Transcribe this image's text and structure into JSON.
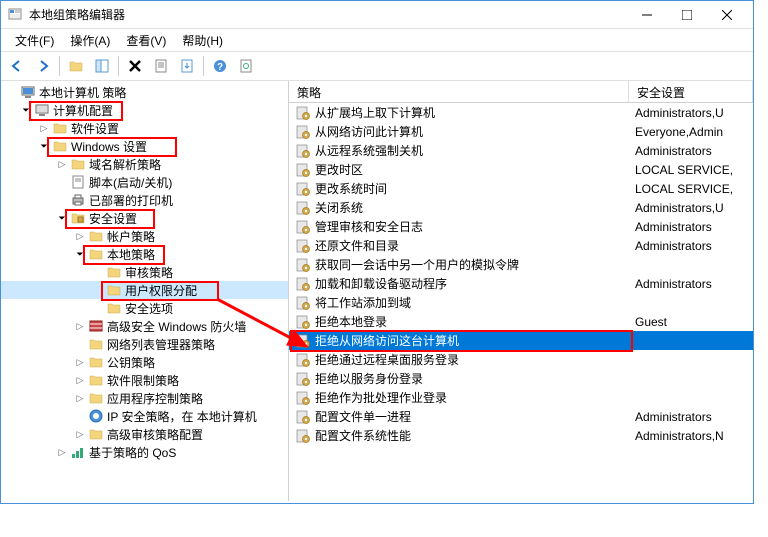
{
  "window": {
    "title": "本地组策略编辑器"
  },
  "menubar": {
    "file": "文件(F)",
    "action": "操作(A)",
    "view": "查看(V)",
    "help": "帮助(H)"
  },
  "tree": {
    "root": "本地计算机 策略",
    "computer_config": "计算机配置",
    "software_settings": "软件设置",
    "windows_settings": "Windows 设置",
    "name_resolution": "域名解析策略",
    "scripts": "脚本(启动/关机)",
    "deployed_printers": "已部署的打印机",
    "security_settings": "安全设置",
    "account_policies": "帐户策略",
    "local_policies": "本地策略",
    "audit_policy": "审核策略",
    "user_rights": "用户权限分配",
    "security_options": "安全选项",
    "windows_firewall": "高级安全 Windows 防火墙",
    "network_list": "网络列表管理器策略",
    "public_key": "公钥策略",
    "software_restriction": "软件限制策略",
    "app_control": "应用程序控制策略",
    "ip_security": "IP 安全策略，在 本地计算机",
    "advanced_audit": "高级审核策略配置",
    "policy_qos": "基于策略的 QoS"
  },
  "list": {
    "headers": {
      "policy": "策略",
      "setting": "安全设置"
    },
    "rows": [
      {
        "policy": "从扩展坞上取下计算机",
        "setting": "Administrators,U"
      },
      {
        "policy": "从网络访问此计算机",
        "setting": "Everyone,Admin"
      },
      {
        "policy": "从远程系统强制关机",
        "setting": "Administrators"
      },
      {
        "policy": "更改时区",
        "setting": "LOCAL SERVICE,"
      },
      {
        "policy": "更改系统时间",
        "setting": "LOCAL SERVICE,"
      },
      {
        "policy": "关闭系统",
        "setting": "Administrators,U"
      },
      {
        "policy": "管理审核和安全日志",
        "setting": "Administrators"
      },
      {
        "policy": "还原文件和目录",
        "setting": "Administrators"
      },
      {
        "policy": "获取同一会话中另一个用户的模拟令牌",
        "setting": ""
      },
      {
        "policy": "加载和卸载设备驱动程序",
        "setting": "Administrators"
      },
      {
        "policy": "将工作站添加到域",
        "setting": ""
      },
      {
        "policy": "拒绝本地登录",
        "setting": "Guest"
      },
      {
        "policy": "拒绝从网络访问这台计算机",
        "setting": "",
        "selected": true
      },
      {
        "policy": "拒绝通过远程桌面服务登录",
        "setting": ""
      },
      {
        "policy": "拒绝以服务身份登录",
        "setting": ""
      },
      {
        "policy": "拒绝作为批处理作业登录",
        "setting": ""
      },
      {
        "policy": "配置文件单一进程",
        "setting": "Administrators"
      },
      {
        "policy": "配置文件系统性能",
        "setting": "Administrators,N"
      }
    ]
  }
}
